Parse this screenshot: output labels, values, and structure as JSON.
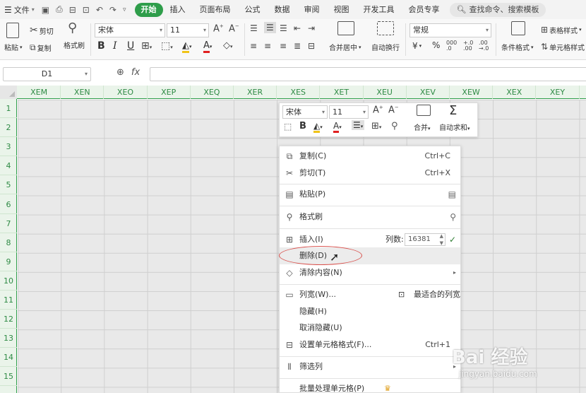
{
  "menubar": {
    "file_label": "文件",
    "tabs": [
      "开始",
      "插入",
      "页面布局",
      "公式",
      "数据",
      "审阅",
      "视图",
      "开发工具",
      "会员专享"
    ],
    "active_tab": "开始",
    "search": "查找命令、搜索模板"
  },
  "ribbon": {
    "paste": "粘贴",
    "cut": "剪切",
    "copy": "复制",
    "format_painter": "格式刷",
    "font_name": "宋体",
    "font_size": "11",
    "bold": "B",
    "italic": "I",
    "underline": "U",
    "merge_center": "合并居中",
    "wrap_text": "自动换行",
    "number_format": "常规",
    "currency": "¥",
    "percent": "%",
    "table_style": "表格样式",
    "conditional_format": "条件格式",
    "cell_style": "单元格样式"
  },
  "formula_bar": {
    "name_box": "D1",
    "fx": "fx"
  },
  "grid": {
    "columns": [
      "XEM",
      "XEN",
      "XEO",
      "XEP",
      "XEQ",
      "XER",
      "XES",
      "XET",
      "XEU",
      "XEV",
      "XEW",
      "XEX",
      "XEY"
    ],
    "rows": [
      "1",
      "2",
      "3",
      "4",
      "5",
      "6",
      "7",
      "8",
      "9",
      "10",
      "11",
      "12",
      "13",
      "14",
      "15"
    ]
  },
  "mini_toolbar": {
    "font_name": "宋体",
    "font_size": "11",
    "merge": "合并",
    "autosum": "自动求和"
  },
  "context_menu": {
    "copy": "复制(C)",
    "copy_sc": "Ctrl+C",
    "cut": "剪切(T)",
    "cut_sc": "Ctrl+X",
    "paste": "粘贴(P)",
    "format_painter": "格式刷",
    "insert": "插入(I)",
    "col_count_label": "列数:",
    "col_count": "16381",
    "delete": "删除(D)",
    "clear": "清除内容(N)",
    "col_width": "列宽(W)...",
    "best_fit": "最适合的列宽",
    "hide": "隐藏(H)",
    "unhide": "取消隐藏(U)",
    "format_cells": "设置单元格格式(F)...",
    "format_cells_sc": "Ctrl+1",
    "filter": "筛选列",
    "batch": "批量处理单元格(P)"
  },
  "watermark": {
    "brand": "Bai 经验",
    "url": "jingyan.baidu.com"
  },
  "colors": {
    "accent": "#2e9d4a",
    "highlight_oval": "#d9534f"
  }
}
